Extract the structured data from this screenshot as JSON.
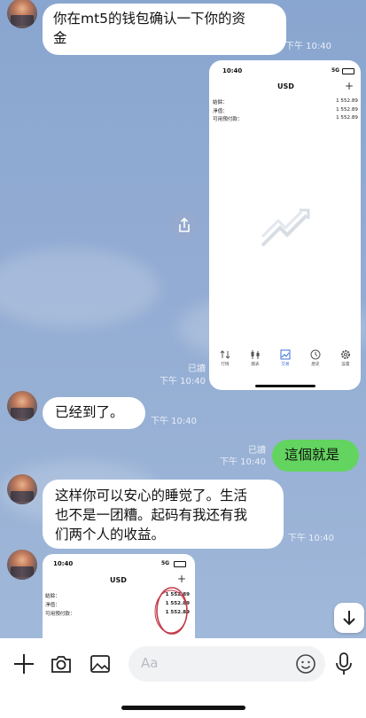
{
  "colors": {
    "chat_bg": "#8fa9cf",
    "bubble_in": "#ffffff",
    "bubble_out": "#63d45f",
    "accent": "#3a6fd8",
    "circle_mark": "#c23a4a"
  },
  "messages": {
    "m1": {
      "text_line1": "你在mt5的钱包确认一下你的资",
      "text_line2": "金",
      "time": "下午 10:40"
    },
    "m2": {
      "read": "已讀",
      "time": "下午 10:40"
    },
    "m3": {
      "text": "已经到了。",
      "time": "下午 10:40"
    },
    "m4": {
      "text": "這個就是",
      "read": "已讀",
      "time": "下午 10:40"
    },
    "m5": {
      "line1": "这样你可以安心的睡觉了。生活",
      "line2": "也不是一团糟。起码有我还有我",
      "line3": "们两个人的收益。",
      "time": "下午 10:40"
    }
  },
  "mt5_screenshot": {
    "status_time": "10:40",
    "status_net": "5G",
    "title": "USD",
    "plus": "+",
    "rows": [
      {
        "label": "結餘：",
        "value": "1 552.89"
      },
      {
        "label": "淨值：",
        "value": "1 552.89"
      },
      {
        "label": "可用預付款：",
        "value": "1 552.89"
      }
    ],
    "tabs": [
      {
        "label": "行情",
        "icon": "updown-arrows-icon"
      },
      {
        "label": "圖表",
        "icon": "candles-icon"
      },
      {
        "label": "交易",
        "icon": "trend-icon"
      },
      {
        "label": "歷史",
        "icon": "history-icon"
      },
      {
        "label": "設置",
        "icon": "gear-icon"
      }
    ]
  },
  "mt5_preview": {
    "status_time": "10:40",
    "status_net": "5G",
    "title": "USD",
    "plus": "+",
    "rows": [
      {
        "label": "結餘：",
        "value": "1 552.89"
      },
      {
        "label": "淨值：",
        "value": "1 552.89"
      },
      {
        "label": "可用預付款：",
        "value": "1 552.89"
      }
    ]
  },
  "composer": {
    "placeholder": "Aa"
  }
}
